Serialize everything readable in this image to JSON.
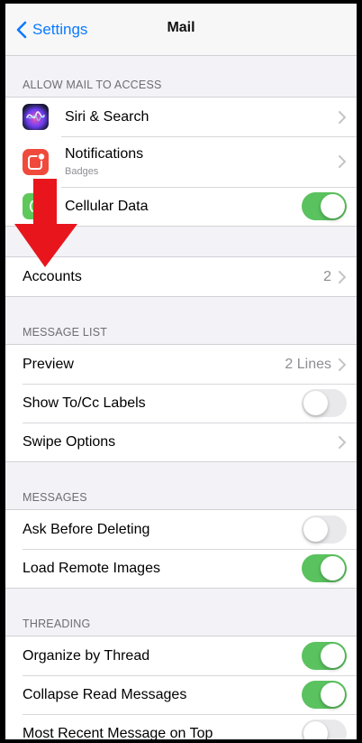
{
  "nav": {
    "back_label": "Settings",
    "title": "Mail"
  },
  "section_access": {
    "header": "ALLOW MAIL TO ACCESS",
    "siri": {
      "label": "Siri & Search",
      "icon": "siri-icon"
    },
    "notifications": {
      "label": "Notifications",
      "sublabel": "Badges",
      "icon": "notifications-icon"
    },
    "cellular": {
      "label": "Cellular Data",
      "icon": "cellular-icon",
      "enabled": true
    }
  },
  "accounts": {
    "label": "Accounts",
    "value": "2"
  },
  "section_message_list": {
    "header": "MESSAGE LIST",
    "preview": {
      "label": "Preview",
      "value": "2 Lines"
    },
    "show_tocc": {
      "label": "Show To/Cc Labels",
      "enabled": false
    },
    "swipe": {
      "label": "Swipe Options"
    }
  },
  "section_messages": {
    "header": "MESSAGES",
    "ask_delete": {
      "label": "Ask Before Deleting",
      "enabled": false
    },
    "load_images": {
      "label": "Load Remote Images",
      "enabled": true
    }
  },
  "section_threading": {
    "header": "THREADING",
    "organize": {
      "label": "Organize by Thread",
      "enabled": true
    },
    "collapse": {
      "label": "Collapse Read Messages",
      "enabled": true
    },
    "most_recent": {
      "label": "Most Recent Message on Top",
      "enabled": false
    }
  },
  "colors": {
    "accent": "#0a7aff",
    "toggle_on": "#5ac25e",
    "annotation_arrow": "#e8161c"
  }
}
